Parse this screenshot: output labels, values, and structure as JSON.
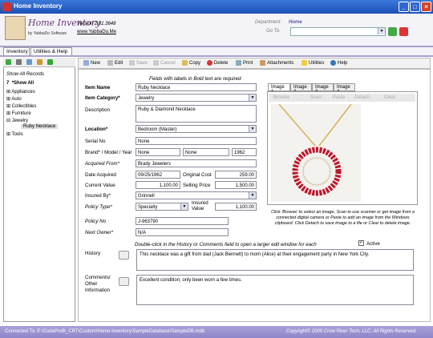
{
  "window": {
    "title": "Home Inventory"
  },
  "header": {
    "logo_title": "Home Inventory",
    "logo_sub": "by YabbaDo Software",
    "version": "Version 2.01.3648",
    "site": "www.YabbaDo.Me",
    "dept_label": "Department:",
    "dept_value": "Home",
    "goto_label": "Go To:",
    "goto_value": ""
  },
  "tabs": [
    "Inventory",
    "Utilities & Help"
  ],
  "tree": {
    "show_all": "Show All Records",
    "root": "*Show All",
    "items": [
      "Appliances",
      "Auto",
      "Collectibles",
      "Furniture",
      "Jewelry",
      "Tools"
    ],
    "child": "Ruby Necklace",
    "num": "7"
  },
  "toolbar": {
    "new": "New",
    "edit": "Edit",
    "save": "Save",
    "cancel": "Cancel",
    "copy": "Copy",
    "delete": "Delete",
    "print": "Print",
    "attachments": "Attachments",
    "utilities": "Utilities",
    "help": "Help"
  },
  "form": {
    "hint": "Fields with labels in Bold text are required",
    "item_name_label": "Item Name",
    "item_name": "Ruby Necklace",
    "category_label": "Item Category*",
    "category": "Jewelry",
    "desc_label": "Description",
    "desc": "Ruby & Diamond Necklace",
    "location_label": "Location*",
    "location": "Bedroom (Master)",
    "serial_label": "Serial No",
    "serial": "None",
    "bmy_label": "Brand* / Model / Year",
    "brand": "None",
    "model": "None",
    "year": "1962",
    "acq_from_label": "Acquired From*",
    "acq_from": "Brady Jewelers",
    "date_label": "Date Acquired",
    "date": "09/25/1962",
    "orig_label": "Original Cost",
    "orig": "259.00",
    "curval_label": "Current Value",
    "curval": "1,100.00",
    "sell_label": "Selling Price",
    "sell": "1,500.00",
    "insured_label": "Insured By*",
    "insured": "Grinnell",
    "policy_type_label": "Policy Type*",
    "policy_type": "Specialty",
    "insval_label": "Insured Value",
    "insval": "1,100.00",
    "policy_no_label": "Policy No",
    "policy_no": "J-963790",
    "next_owner_label": "Next Owner*",
    "next_owner": "N/A",
    "dbl_hint": "Double-click in the History or Comments field to open a larger edit window for each",
    "active_label": "Active",
    "history_label": "History",
    "history": "This necklace was a gift from dad (Jack Bennett) to mom (Alice) at their engagement party in New York City.",
    "comments_label": "Comments/ Other Information",
    "comments": "Excellent condition; only been worn a few times."
  },
  "images": {
    "tabs": [
      "Image 1",
      "Image 2",
      "Image 3",
      "Image 4"
    ],
    "tools": [
      "Browse",
      "Scan",
      "Paste",
      "Detach",
      "Clear"
    ],
    "caption": "Click 'Browse' to select an image, Scan to use scanner or get image from a connected digital camera or Paste to add an image from the Windows clipboard. Click Detach to save image to a file or Clear to delete image."
  },
  "status": {
    "left": "Connected To: E:\\CodeProfit_CRT\\Custom\\Home Inventory\\SampleDatabase\\SampleDB.mdb",
    "right": "Copyright© 2009 Crow River Tech, LLC.  All Rights Reserved."
  }
}
